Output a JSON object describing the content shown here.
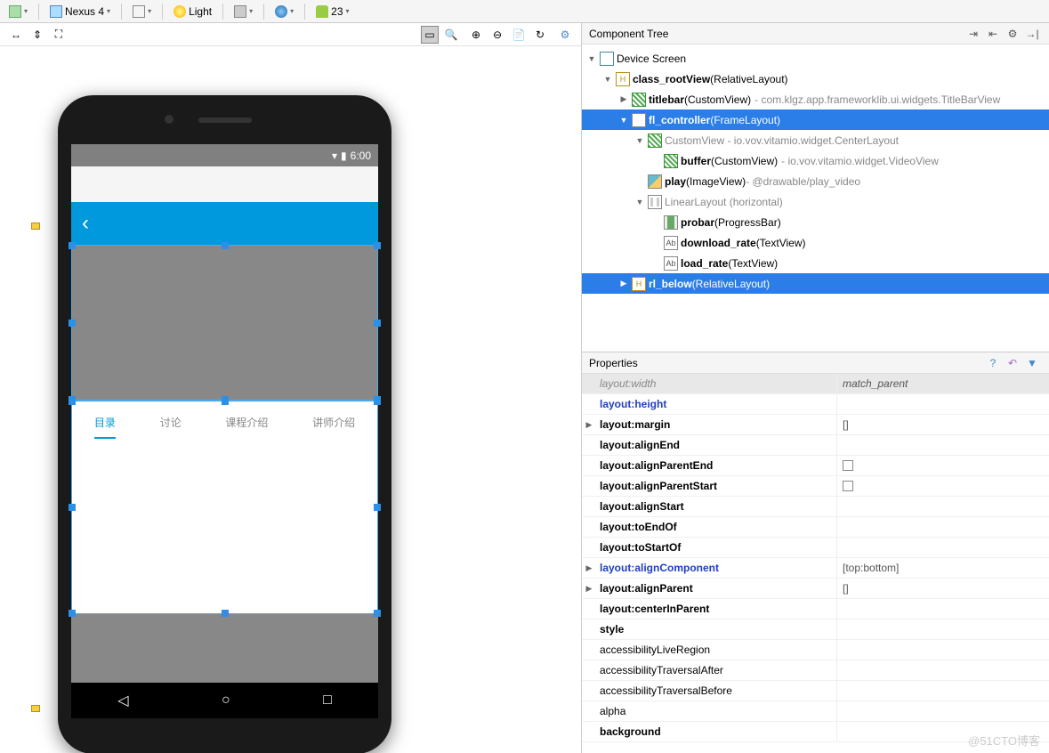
{
  "toolbar": {
    "device": "Nexus 4",
    "theme": "Light",
    "api": "23"
  },
  "phone": {
    "time": "6:00",
    "tabs": [
      "目录",
      "讨论",
      "课程介绍",
      "讲师介绍"
    ]
  },
  "componentTree": {
    "title": "Component Tree",
    "root": "Device Screen",
    "items": [
      {
        "indent": 1,
        "arrow": "▼",
        "icon": "rel",
        "name": "class_rootView",
        "type": "(RelativeLayout)",
        "selected": false
      },
      {
        "indent": 2,
        "arrow": "▶",
        "icon": "hatch",
        "name": "titlebar",
        "type": "(CustomView)",
        "extra": "- com.klgz.app.frameworklib.ui.widgets.TitleBarView",
        "selected": false
      },
      {
        "indent": 2,
        "arrow": "▼",
        "icon": "frame",
        "name": "fl_controller",
        "type": "(FrameLayout)",
        "selected": true
      },
      {
        "indent": 3,
        "arrow": "▼",
        "icon": "hatch",
        "name": "",
        "type": "CustomView - io.vov.vitamio.widget.CenterLayout",
        "dim": true,
        "selected": false
      },
      {
        "indent": 4,
        "arrow": "",
        "icon": "hatch",
        "name": "buffer",
        "type": "(CustomView)",
        "extra": "- io.vov.vitamio.widget.VideoView",
        "selected": false
      },
      {
        "indent": 3,
        "arrow": "",
        "icon": "img",
        "name": "play",
        "type": "(ImageView)",
        "extra": "- @drawable/play_video",
        "dimextra": true,
        "selected": false
      },
      {
        "indent": 3,
        "arrow": "▼",
        "icon": "ll",
        "name": "",
        "type": "LinearLayout (horizontal)",
        "dim": true,
        "selected": false
      },
      {
        "indent": 4,
        "arrow": "",
        "icon": "prog",
        "name": "probar",
        "type": "(ProgressBar)",
        "selected": false
      },
      {
        "indent": 4,
        "arrow": "",
        "icon": "ab",
        "name": "download_rate",
        "type": "(TextView)",
        "selected": false
      },
      {
        "indent": 4,
        "arrow": "",
        "icon": "ab",
        "name": "load_rate",
        "type": "(TextView)",
        "selected": false
      },
      {
        "indent": 2,
        "arrow": "▶",
        "icon": "rel",
        "name": "rl_below",
        "type": "(RelativeLayout)",
        "selected": true
      }
    ]
  },
  "properties": {
    "title": "Properties",
    "rows": [
      {
        "name": "layout:width",
        "value": "match_parent",
        "hdr": true
      },
      {
        "name": "layout:height",
        "value": "",
        "blue": true
      },
      {
        "name": "layout:margin",
        "value": "[]",
        "exp": "▶",
        "bold": true
      },
      {
        "name": "layout:alignEnd",
        "value": "",
        "bold": true
      },
      {
        "name": "layout:alignParentEnd",
        "value": "",
        "checkbox": true,
        "bold": true
      },
      {
        "name": "layout:alignParentStart",
        "value": "",
        "checkbox": true,
        "bold": true
      },
      {
        "name": "layout:alignStart",
        "value": "",
        "bold": true
      },
      {
        "name": "layout:toEndOf",
        "value": "",
        "bold": true
      },
      {
        "name": "layout:toStartOf",
        "value": "",
        "bold": true
      },
      {
        "name": "layout:alignComponent",
        "value": "[top:bottom]",
        "exp": "▶",
        "blue": true
      },
      {
        "name": "layout:alignParent",
        "value": "[]",
        "exp": "▶",
        "bold": true
      },
      {
        "name": "layout:centerInParent",
        "value": "",
        "bold": true
      },
      {
        "name": "style",
        "value": "",
        "bold": true
      },
      {
        "name": "accessibilityLiveRegion",
        "value": ""
      },
      {
        "name": "accessibilityTraversalAfter",
        "value": ""
      },
      {
        "name": "accessibilityTraversalBefore",
        "value": ""
      },
      {
        "name": "alpha",
        "value": ""
      },
      {
        "name": "background",
        "value": "",
        "bold": true
      }
    ]
  },
  "watermark": "@51CTO博客"
}
